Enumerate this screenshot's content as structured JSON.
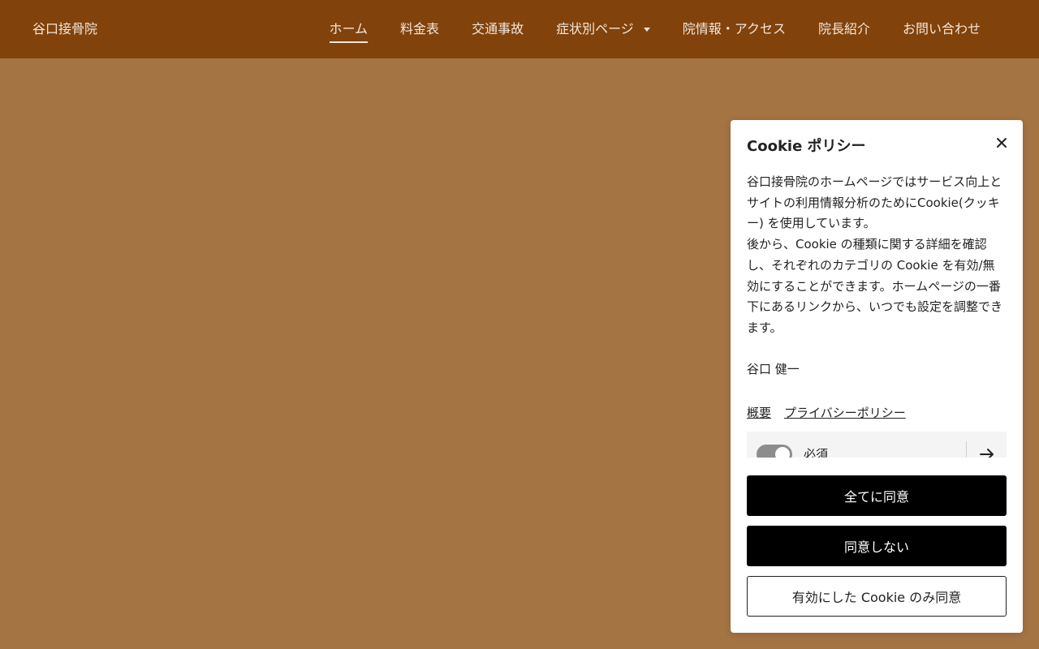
{
  "header": {
    "site_title": "谷口接骨院",
    "nav": [
      {
        "label": "ホーム",
        "active": true
      },
      {
        "label": "料金表"
      },
      {
        "label": "交通事故"
      },
      {
        "label": "症状別ページ",
        "dropdown": true
      },
      {
        "label": "院情報・アクセス"
      },
      {
        "label": "院長紹介"
      },
      {
        "label": "お問い合わせ"
      }
    ]
  },
  "cookie": {
    "title": "Cookie ポリシー",
    "body": "谷口接骨院のホームページではサービス向上とサイトの利用情報分析のためにCookie(クッキー) を使用しています。\n後から、Cookie の種類に関する詳細を確認し、それぞれのカテゴリの Cookie を有効/無効にすることができます。ホームページの一番下にあるリンクから、いつでも設定を調整できます。",
    "signature": "谷口 健一",
    "links": {
      "overview": "概要",
      "privacy": "プライバシーポリシー"
    },
    "category": {
      "label": "必須",
      "enabled": true
    },
    "buttons": {
      "accept_all": "全てに同意",
      "decline": "同意しない",
      "accept_selected": "有効にした Cookie のみ同意"
    }
  },
  "colors": {
    "header_bg": "#81420b",
    "page_bg": "#a57443",
    "button_dark": "#000000"
  }
}
